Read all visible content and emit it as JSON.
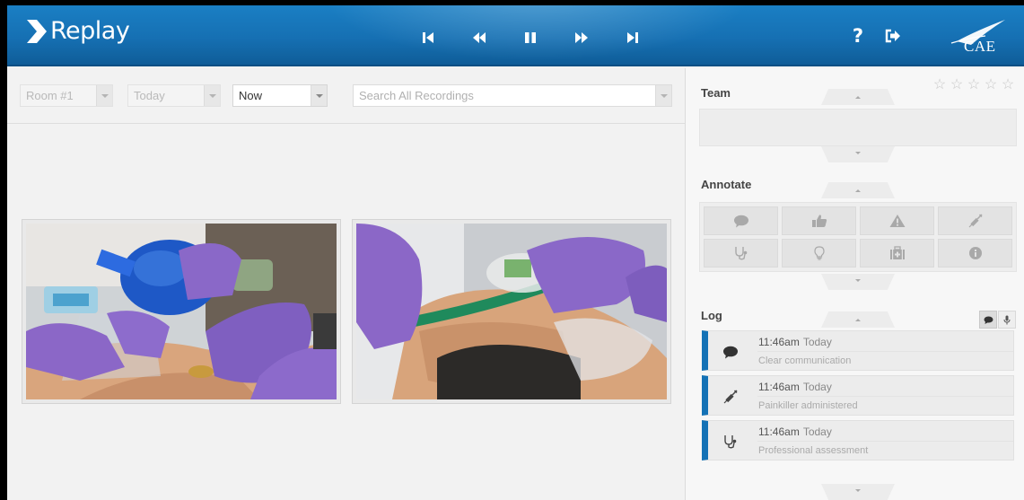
{
  "app": {
    "name": "Replay",
    "brand": "CAE"
  },
  "colors": {
    "header": "#1670b3",
    "accent": "#1472b6",
    "glove": "#8b67c7"
  },
  "transport": [
    {
      "name": "skip-to-start-icon"
    },
    {
      "name": "rewind-icon"
    },
    {
      "name": "pause-icon"
    },
    {
      "name": "fast-forward-icon"
    },
    {
      "name": "skip-to-end-icon"
    }
  ],
  "header_actions": {
    "help_label": "?",
    "logout_icon": "logout-icon"
  },
  "filters": {
    "room": "Room #1",
    "day": "Today",
    "time": "Now",
    "search_placeholder": "Search All Recordings"
  },
  "panels": {
    "team": {
      "title": "Team"
    },
    "annotate": {
      "title": "Annotate",
      "buttons": [
        "comment-icon",
        "thumbs-up-icon",
        "warning-icon",
        "syringe-icon",
        "stethoscope-icon",
        "lightbulb-icon",
        "medkit-icon",
        "info-icon"
      ]
    },
    "log": {
      "title": "Log",
      "entries": [
        {
          "time": "11:46am",
          "day": "Today",
          "text": "Clear communication",
          "icon": "comment-icon"
        },
        {
          "time": "11:46am",
          "day": "Today",
          "text": "Painkiller administered",
          "icon": "syringe-icon"
        },
        {
          "time": "11:46am",
          "day": "Today",
          "text": "Professional assessment",
          "icon": "stethoscope-icon"
        }
      ]
    }
  },
  "rating": {
    "stars": 5,
    "filled": 0
  }
}
